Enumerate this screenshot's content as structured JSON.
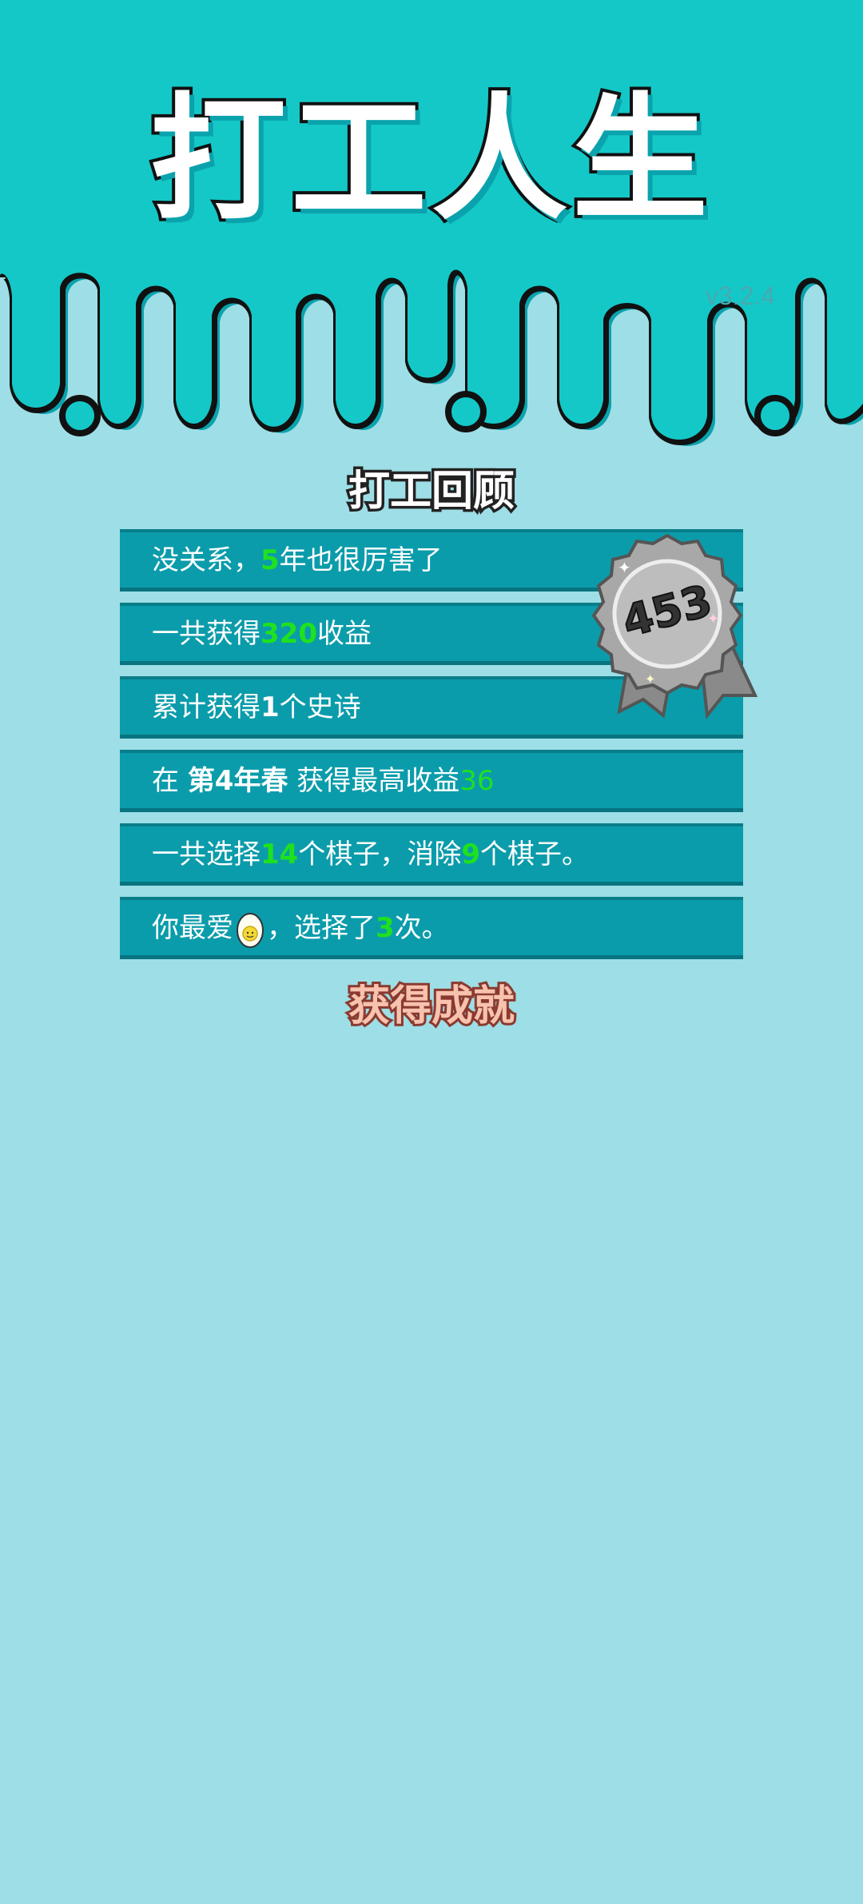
{
  "header": {
    "title": "打工人生",
    "version": "v3.2.4",
    "colors": {
      "header_bg": "#14c8c8",
      "page_bg": "#9edee6"
    }
  },
  "review": {
    "title": "打工回顾",
    "rows": [
      {
        "a": "没关系，",
        "num": "5",
        "b": "年也很厉害了"
      },
      {
        "a": "一共获得",
        "num": "320",
        "b": "收益"
      },
      {
        "a": "累计获得",
        "num": "1",
        "b": "个史诗"
      },
      {
        "a": "在 ",
        "bold": "第4年春",
        "b": " 获得最高收益",
        "num": "36"
      },
      {
        "a": "一共选择",
        "num1": "14",
        "b": "个棋子，消除",
        "num2": "9",
        "c": "个棋子。"
      },
      {
        "a": "你最爱",
        "icon": "boiled-egg-icon",
        "b": "，选择了",
        "num": "3",
        "c": "次。"
      }
    ]
  },
  "badge": {
    "value": "453",
    "icon": "silver-medal-ribbon-icon"
  },
  "achievements": {
    "title": "获得成就"
  }
}
